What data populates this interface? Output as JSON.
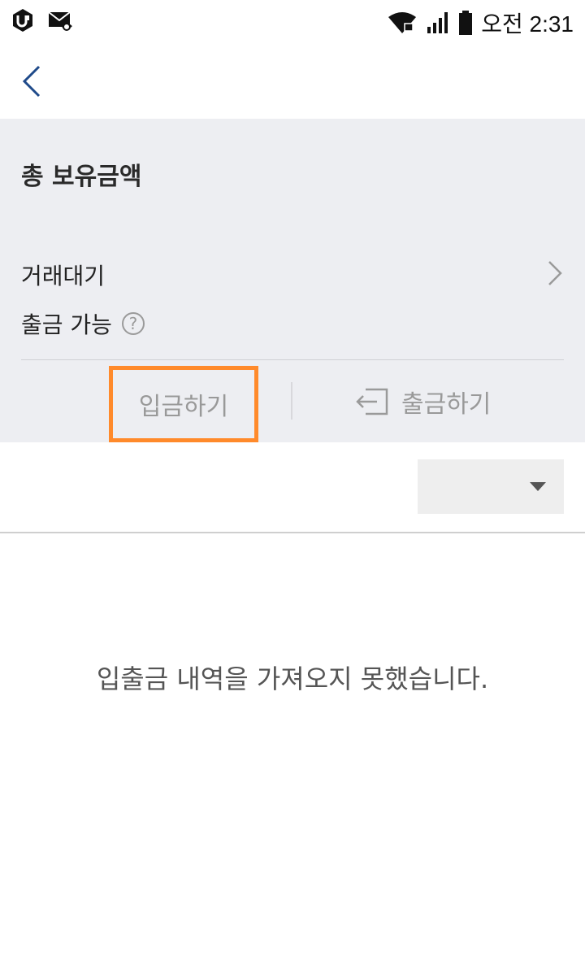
{
  "status_bar": {
    "time": "오전 2:31",
    "icons": [
      "u-plus-icon",
      "missed-mail-icon",
      "wifi-icon",
      "signal-icon",
      "battery-icon"
    ]
  },
  "nav": {
    "back_icon": "chevron-left-icon"
  },
  "summary": {
    "title": "총 보유금액",
    "pending_label": "거래대기",
    "withdrawable_label": "출금 가능",
    "help_glyph": "?"
  },
  "actions": {
    "deposit_label": "입금하기",
    "withdraw_label": "출금하기",
    "highlight_color": "#ff8a2b"
  },
  "history": {
    "empty_message": "입출금 내역을 가져오지 못했습니다."
  },
  "colors": {
    "summary_bg": "#edeef2",
    "back_arrow": "#1f4a8a"
  }
}
